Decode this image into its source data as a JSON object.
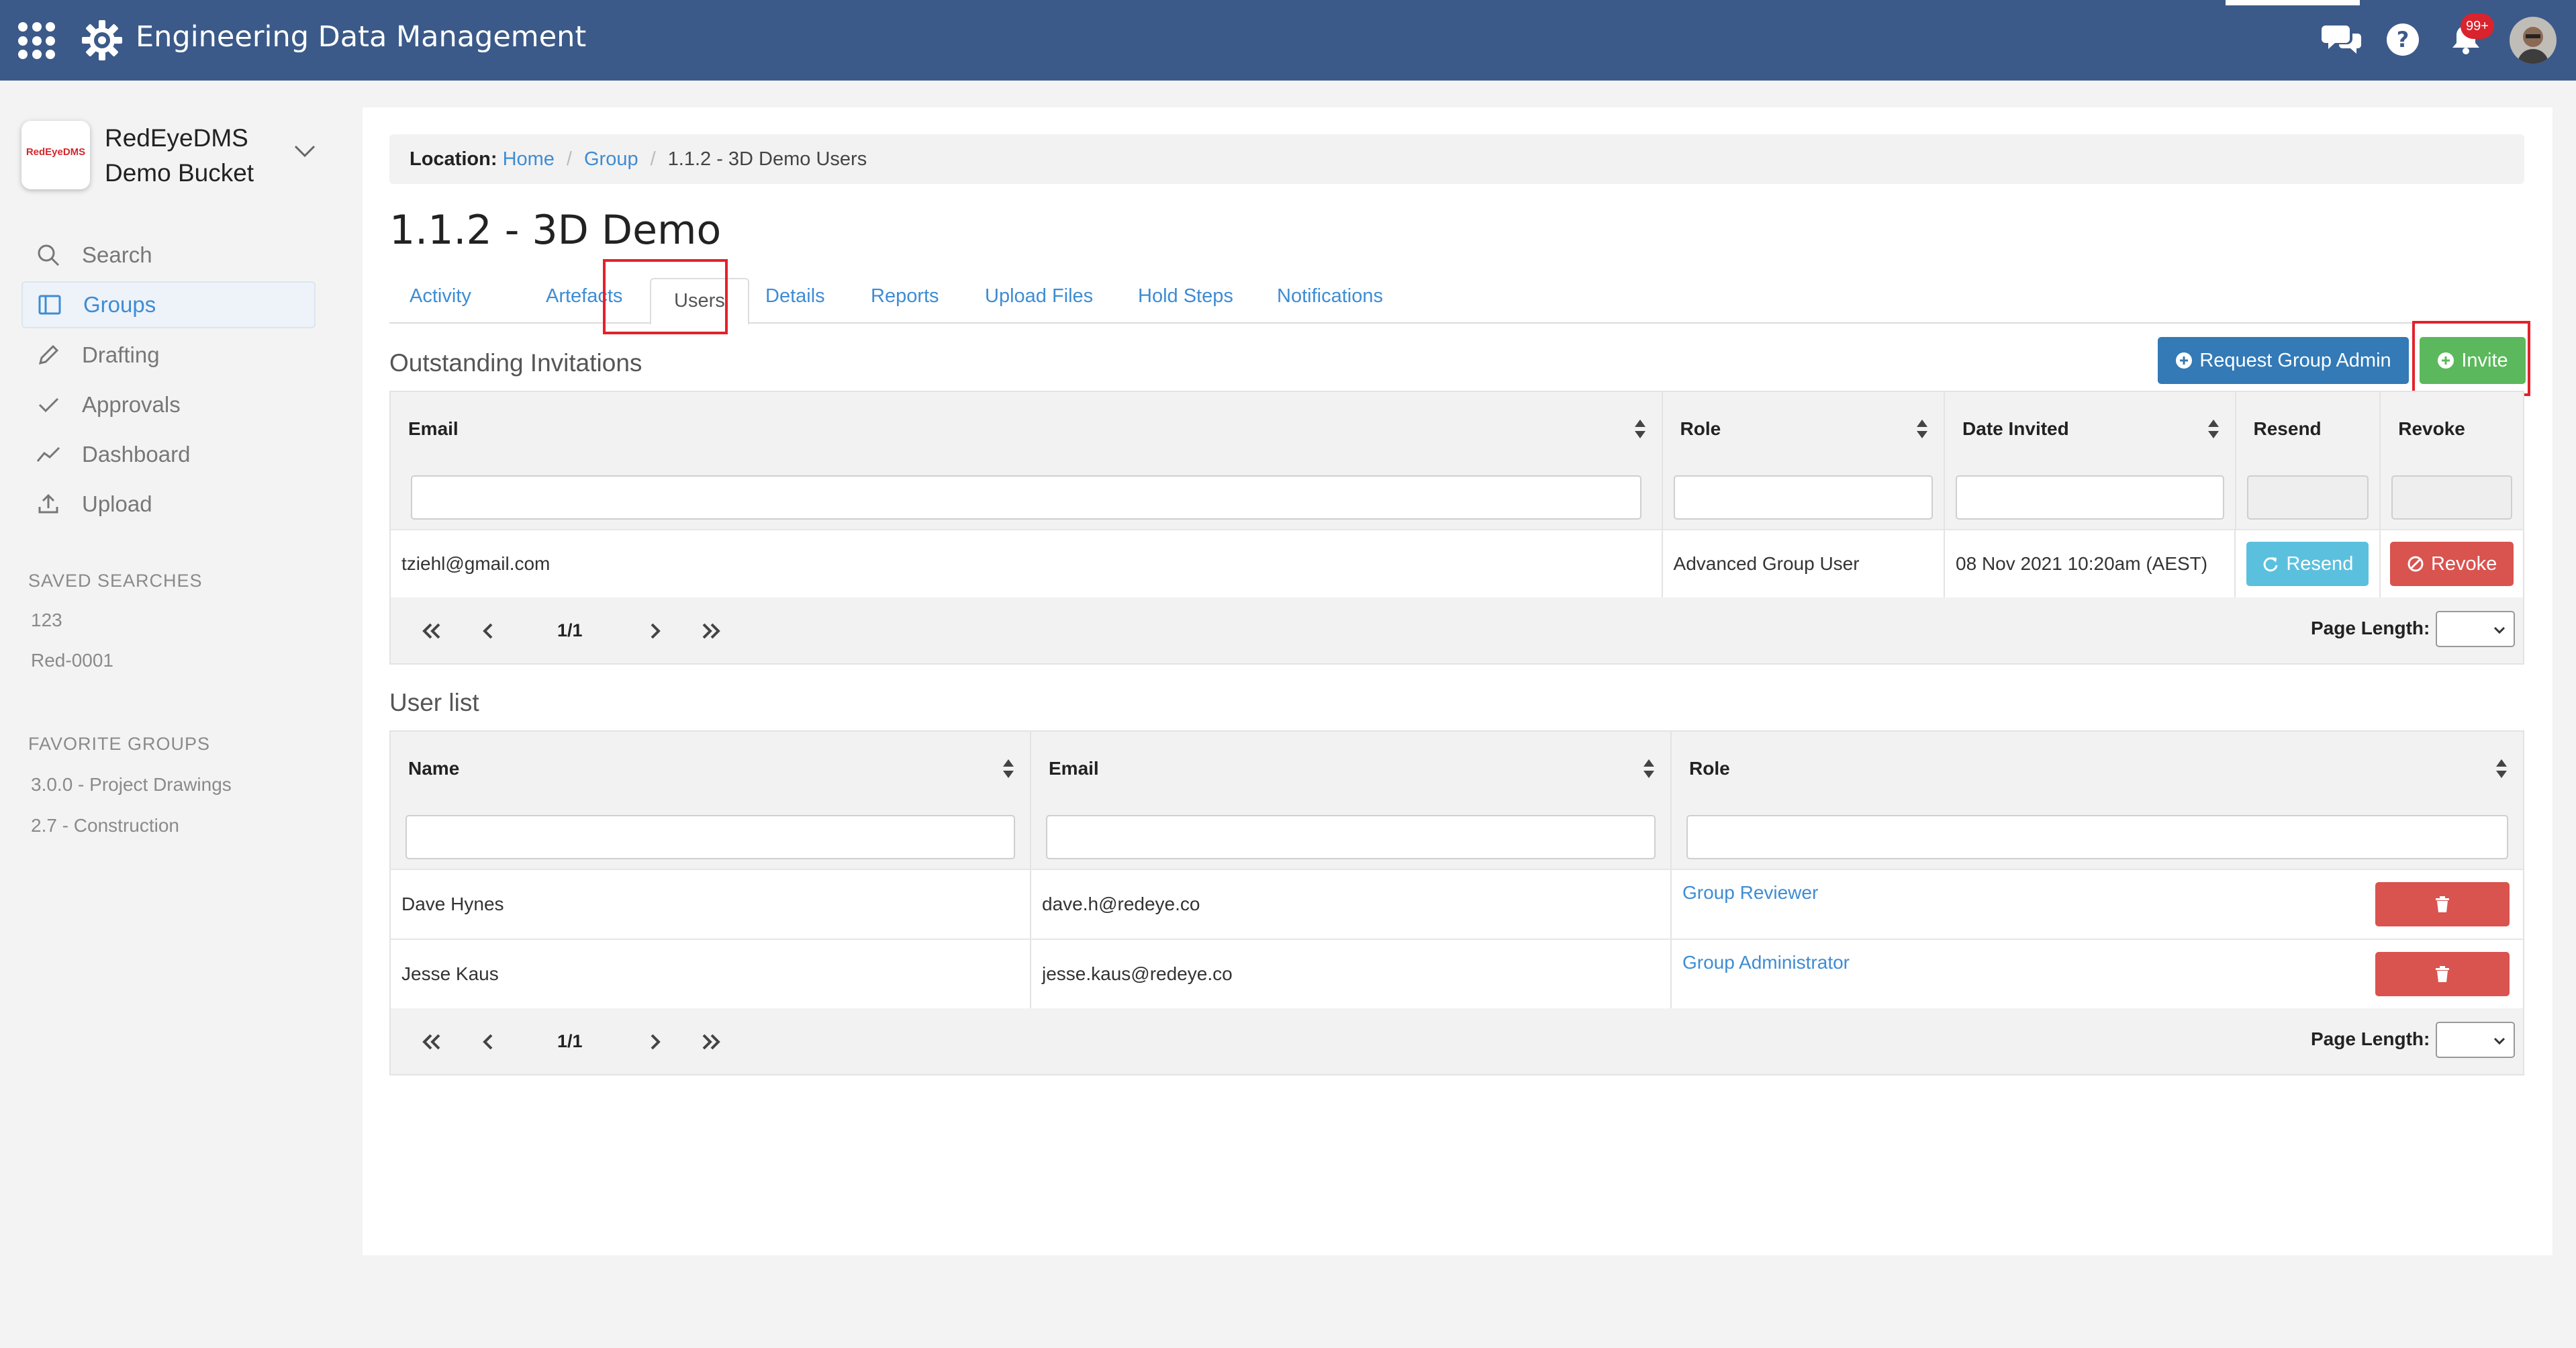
{
  "app": {
    "title": "Engineering Data Management",
    "notifications_badge": "99+"
  },
  "sidebar": {
    "bucket_name_line1": "RedEyeDMS",
    "bucket_name_line2": "Demo Bucket",
    "logo_text": "RedEyeDMS",
    "nav": [
      {
        "label": "Search",
        "icon": "search-icon"
      },
      {
        "label": "Groups",
        "icon": "groups-icon",
        "active": true
      },
      {
        "label": "Drafting",
        "icon": "pencil-icon"
      },
      {
        "label": "Approvals",
        "icon": "check-icon"
      },
      {
        "label": "Dashboard",
        "icon": "chart-line-icon"
      },
      {
        "label": "Upload",
        "icon": "upload-icon"
      }
    ],
    "saved_searches_heading": "SAVED SEARCHES",
    "saved_searches": [
      "123",
      "Red-0001"
    ],
    "favorite_groups_heading": "FAVORITE GROUPS",
    "favorite_groups": [
      "3.0.0 - Project Drawings",
      "2.7 - Construction"
    ]
  },
  "breadcrumb": {
    "label": "Location:",
    "items": [
      "Home",
      "Group"
    ],
    "current": "1.1.2 - 3D Demo Users"
  },
  "page_title": "1.1.2 - 3D Demo",
  "tabs": [
    "Activity",
    "Artefacts",
    "Users",
    "Details",
    "Reports",
    "Upload Files",
    "Hold Steps",
    "Notifications"
  ],
  "invitations": {
    "title": "Outstanding Invitations",
    "request_admin_label": "Request Group Admin",
    "invite_label": "Invite",
    "columns": [
      "Email",
      "Role",
      "Date Invited",
      "Resend",
      "Revoke"
    ],
    "rows": [
      {
        "email": "tziehl@gmail.com",
        "role": "Advanced Group User",
        "date": "08 Nov 2021 10:20am (AEST)",
        "resend": "Resend",
        "revoke": "Revoke"
      }
    ],
    "page": "1/1",
    "page_length_label": "Page Length:"
  },
  "users": {
    "title": "User list",
    "columns": [
      "Name",
      "Email",
      "Role"
    ],
    "rows": [
      {
        "name": "Dave Hynes",
        "email": "dave.h@redeye.co",
        "role": "Group Reviewer"
      },
      {
        "name": "Jesse Kaus",
        "email": "jesse.kaus@redeye.co",
        "role": "Group Administrator"
      }
    ],
    "page": "1/1",
    "page_length_label": "Page Length:"
  },
  "colors": {
    "header": "#3b5a89",
    "link": "#3e8cd4",
    "primary": "#337ab7",
    "success": "#5cb85c",
    "info": "#5bc0de",
    "danger": "#d9534f",
    "highlight": "#e3222a"
  }
}
